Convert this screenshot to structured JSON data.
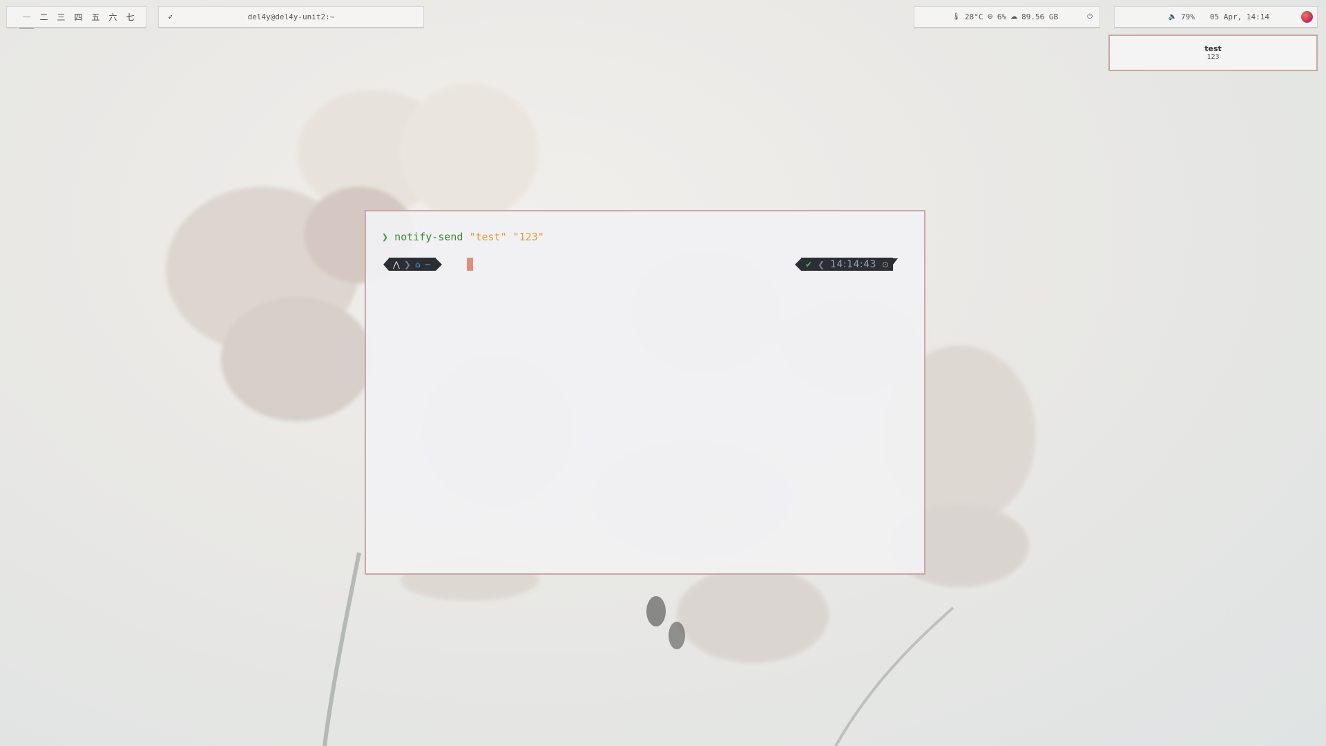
{
  "workspaces": {
    "items": [
      "一",
      "二",
      "三",
      "四",
      "五",
      "六",
      "七"
    ],
    "active_index": 0
  },
  "title_bar": {
    "launcher_icon": "rocket-icon",
    "window_title": "del4y@del4y-unit2:~"
  },
  "system_bar": {
    "temperature": "28°C",
    "cpu": "6%",
    "disk": "89.56 GB",
    "icons": [
      "thermometer-icon",
      "cpu-icon",
      "cloud-icon",
      "power-icon"
    ]
  },
  "clock_bar": {
    "volume": "79%",
    "datetime": "05 Apr, 14:14",
    "icons": [
      "volume-icon",
      "arch-logo"
    ]
  },
  "notification": {
    "summary": "test",
    "body": "123"
  },
  "terminal": {
    "prompt_symbol": "❯",
    "command": "notify-send",
    "arg1": "\"test\"",
    "arg2": "\"123\"",
    "path": "~",
    "status": "✔",
    "time": "14:14:43"
  },
  "colors": {
    "accent_border": "#c9a6a1",
    "command_green": "#3a8a2f",
    "string_orange": "#e49a3c",
    "cursor": "#e08c80",
    "segment_dark": "#2b2f33"
  }
}
